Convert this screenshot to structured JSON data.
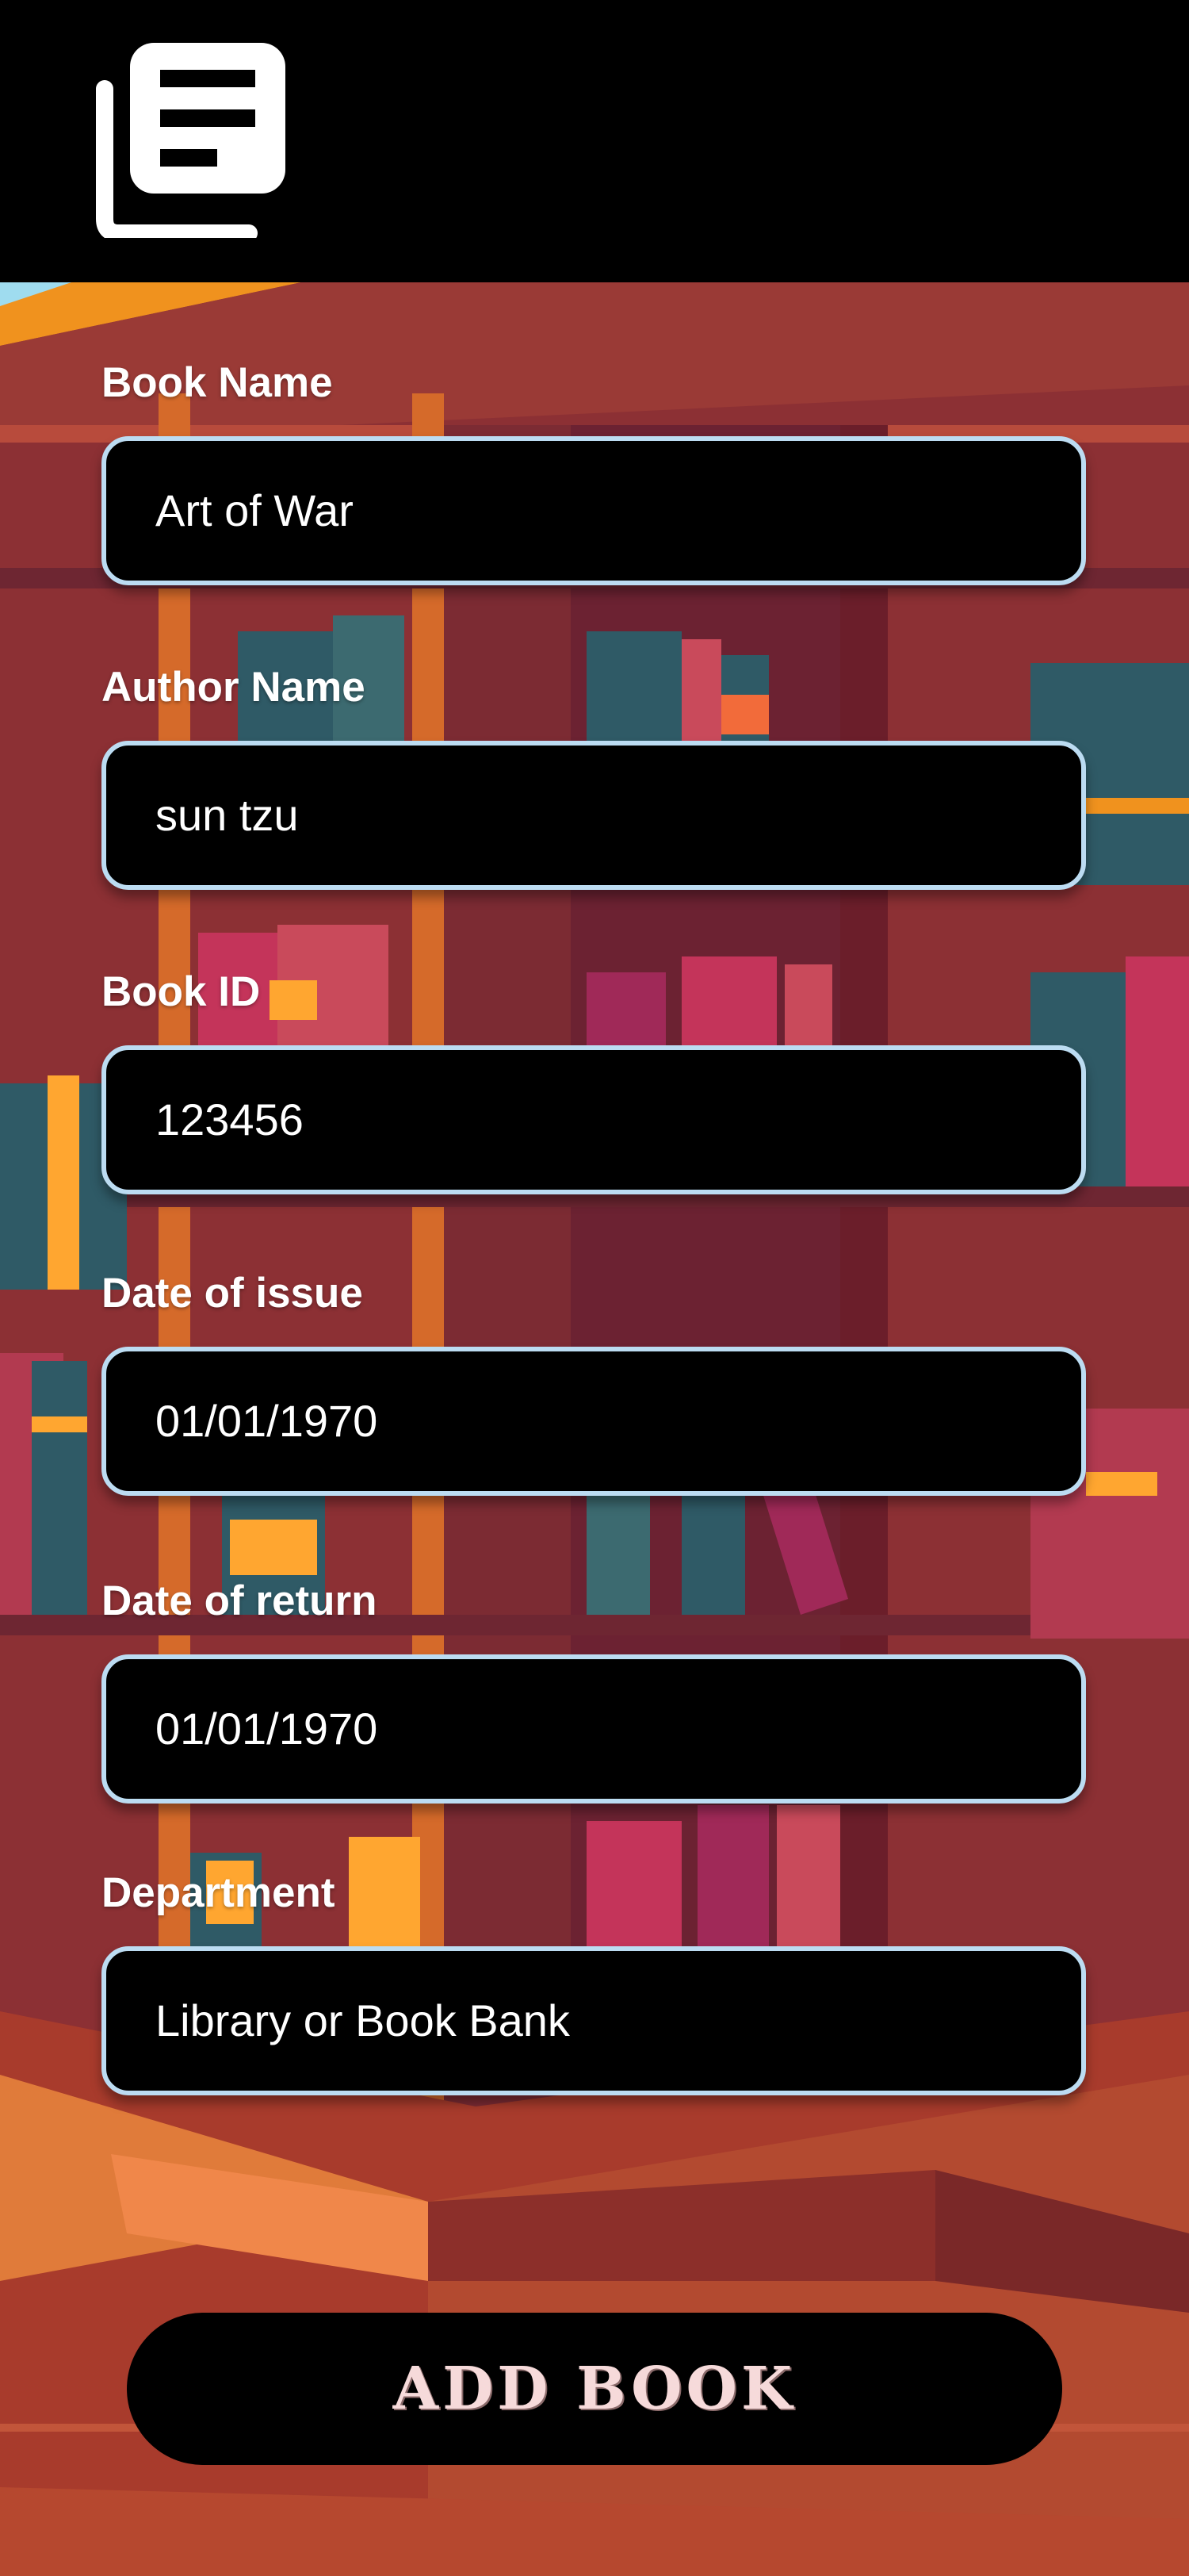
{
  "header": {
    "logo_icon": "book-list-icon"
  },
  "form": {
    "fields": [
      {
        "label": "Book Name",
        "value": "Art of War"
      },
      {
        "label": "Author Name",
        "value": "sun tzu"
      },
      {
        "label": "Book ID",
        "value": "123456"
      },
      {
        "label": "Date of issue",
        "value": "01/01/1970"
      },
      {
        "label": "Date of return",
        "value": "01/01/1970"
      },
      {
        "label": "Department",
        "value": "Library or Book Bank"
      }
    ]
  },
  "actions": {
    "add_book_label": "ADD BOOK"
  },
  "colors": {
    "header_bg": "#000000",
    "field_bg": "#000000",
    "field_border": "#bcdcf2",
    "label_text": "#ffffff",
    "button_text": "#f6dada"
  }
}
